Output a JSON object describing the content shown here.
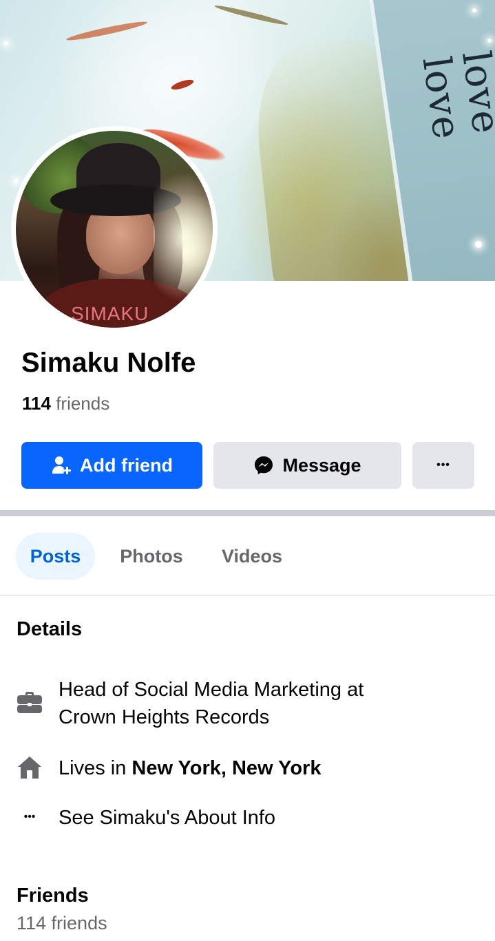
{
  "profile": {
    "name": "Simaku Nolfe",
    "friends_number": "114",
    "friends_word": "friends",
    "cover_text": "love",
    "avatar_watermark": "SIMAKU"
  },
  "actions": {
    "add_friend_label": "Add friend",
    "message_label": "Message",
    "more_label": "•••"
  },
  "tabs": [
    {
      "label": "Posts",
      "active": true
    },
    {
      "label": "Photos",
      "active": false
    },
    {
      "label": "Videos",
      "active": false
    }
  ],
  "details": {
    "title": "Details",
    "work_line1": "Head of Social Media Marketing at",
    "work_line2": "Crown Heights Records",
    "lives_prefix": "Lives in ",
    "lives_place": "New York, New York",
    "about_link": "See Simaku's About Info",
    "more_icon": "•••"
  },
  "friends_section": {
    "title": "Friends",
    "count_text": "114 friends"
  },
  "colors": {
    "primary_blue": "#0866ff",
    "secondary_button": "#e4e6eb",
    "active_tab_bg": "#ebf5ff",
    "active_tab_text": "#0064d1",
    "muted_text": "#65676b"
  }
}
